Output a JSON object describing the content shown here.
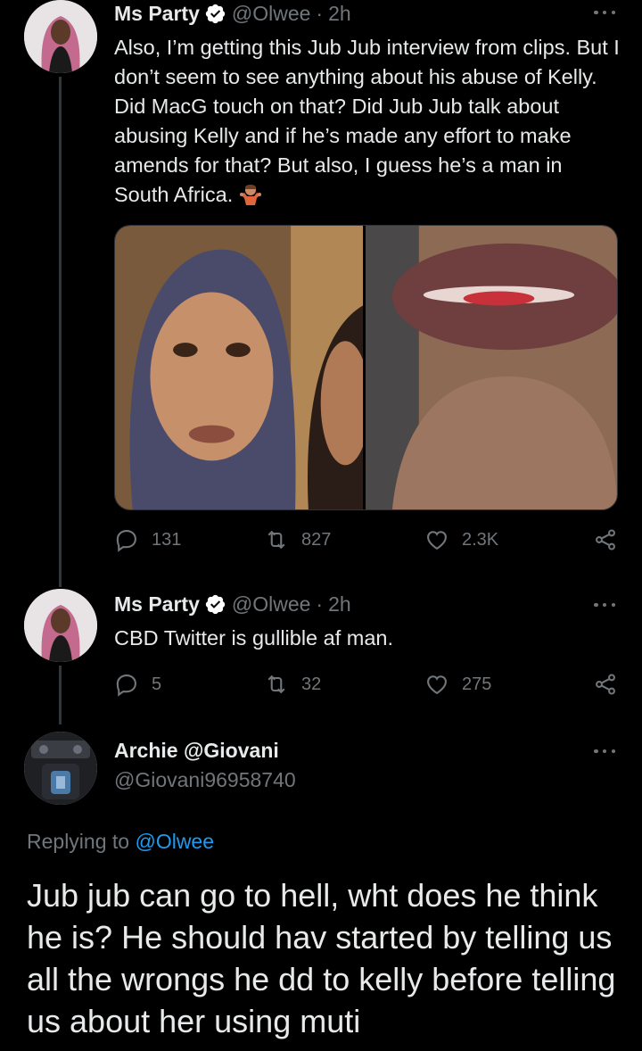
{
  "tweet1": {
    "name": "Ms Party",
    "handle": "@Olwee",
    "time": "2h",
    "text": "Also, I’m getting this Jub Jub interview from clips. But I don’t seem to see anything about his abuse of Kelly. Did MacG touch on that? Did Jub Jub talk about abusing Kelly and if he’s made any effort to make amends for that? But also, I guess he’s a man in South Africa.",
    "emoji": "person-shrugging-emoji",
    "media": [
      "face-photo",
      "lips-photo"
    ],
    "replies": "131",
    "retweets": "827",
    "likes": "2.3K"
  },
  "tweet2": {
    "name": "Ms Party",
    "handle": "@Olwee",
    "time": "2h",
    "text": "CBD Twitter is gullible af man.",
    "replies": "5",
    "retweets": "32",
    "likes": "275"
  },
  "reply": {
    "name": "Archie @Giovani",
    "handle": "@Giovani96958740",
    "replying_label": "Replying to",
    "replying_to": "@Olwee",
    "text": "Jub jub can go to hell, wht does he think he is? He should hav started by telling us all the wrongs he dd to kelly before telling us about her using muti"
  },
  "icons": {
    "verified": "verified-badge-icon",
    "more": "more-options-icon",
    "reply": "reply-icon",
    "retweet": "retweet-icon",
    "like": "heart-icon",
    "share": "share-icon"
  },
  "colors": {
    "background": "#000000",
    "text": "#e7e9ea",
    "muted": "#71767b",
    "link": "#1d9bf0",
    "verified": "#ffffff"
  }
}
